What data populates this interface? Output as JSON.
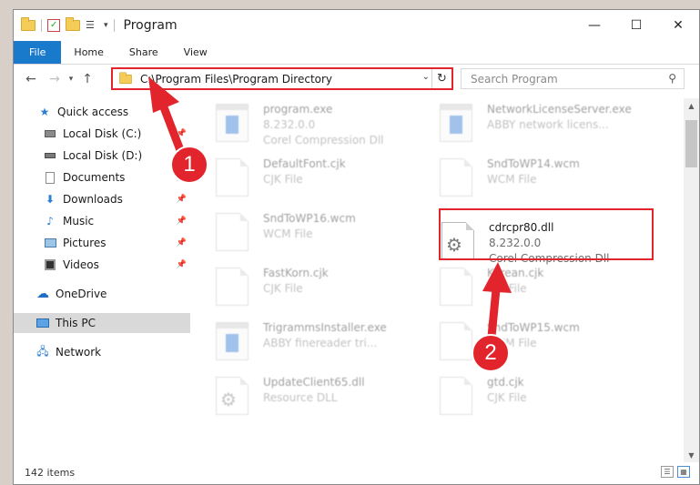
{
  "window": {
    "title": "Program",
    "controls": {
      "minimize": "—",
      "maximize": "☐",
      "close": "✕"
    }
  },
  "ribbon": {
    "tabs": [
      {
        "label": "File"
      },
      {
        "label": "Home"
      },
      {
        "label": "Share"
      },
      {
        "label": "View"
      }
    ]
  },
  "address": {
    "path": "C:\\Program Files\\Program Directory"
  },
  "search": {
    "placeholder": "Search Program"
  },
  "nav": {
    "items": [
      {
        "label": "Quick access"
      },
      {
        "label": "Local Disk (C:)"
      },
      {
        "label": "Local Disk (D:)"
      },
      {
        "label": "Documents"
      },
      {
        "label": "Downloads"
      },
      {
        "label": "Music"
      },
      {
        "label": "Pictures"
      },
      {
        "label": "Videos"
      },
      {
        "label": "OneDrive"
      },
      {
        "label": "This PC"
      },
      {
        "label": "Network"
      }
    ],
    "selected": "This PC"
  },
  "files": [
    {
      "name": "program.exe",
      "line2": "8.232.0.0",
      "line3": "Corel Compression Dll"
    },
    {
      "name": "NetworkLicenseServer.exe",
      "line2": "ABBY network licens..."
    },
    {
      "name": "DefaultFont.cjk",
      "line2": "CJK File"
    },
    {
      "name": "SndToWP14.wcm",
      "line2": "WCM File"
    },
    {
      "name": "SndToWP16.wcm",
      "line2": "WCM File"
    },
    {
      "name": "cdrcpr80.dll",
      "line2": "8.232.0.0",
      "line3": "Corel Compression Dll"
    },
    {
      "name": "FastKorn.cjk",
      "line2": "CJK File"
    },
    {
      "name": "Korean.cjk",
      "line2": "CJK File"
    },
    {
      "name": "TrigrammsInstaller.exe",
      "line2": "ABBY finereader tri..."
    },
    {
      "name": "SndToWP15.wcm",
      "line2": "WCM File"
    },
    {
      "name": "UpdateClient65.dll",
      "line2": "Resource DLL"
    },
    {
      "name": "gtd.cjk",
      "line2": "CJK File"
    }
  ],
  "status": {
    "items_count": "142 items"
  },
  "annotations": {
    "step1": "1",
    "step2": "2"
  },
  "colors": {
    "accent": "#1979ca",
    "highlight": "#e2252c"
  }
}
